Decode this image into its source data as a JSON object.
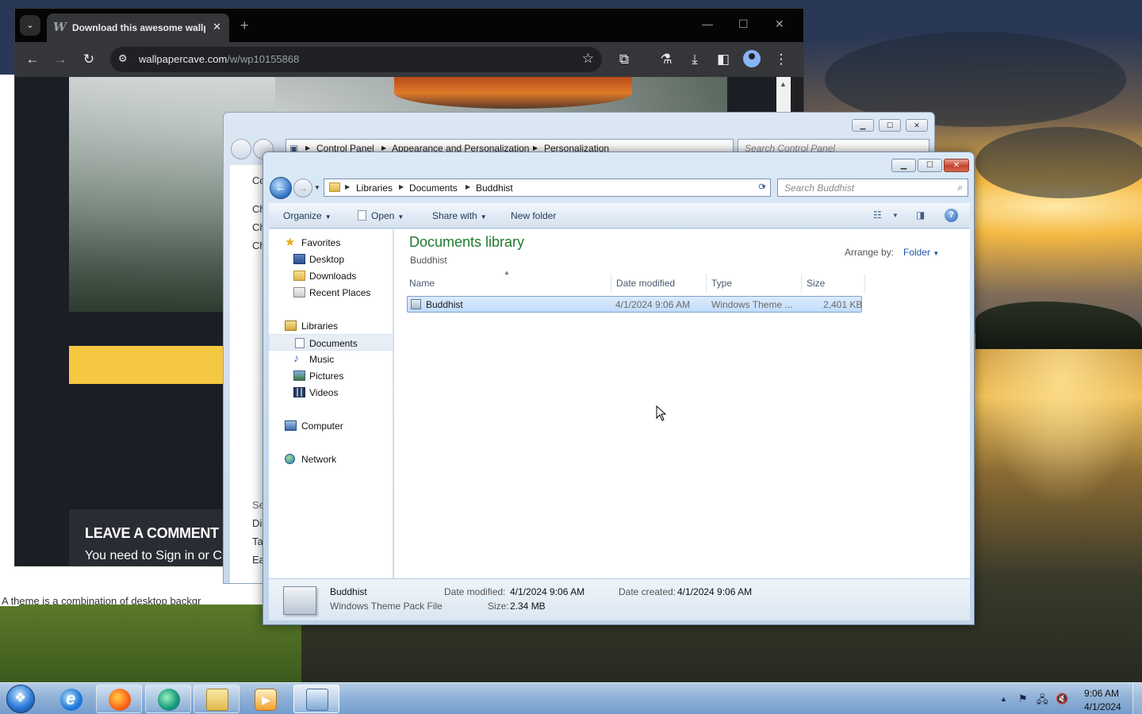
{
  "browser": {
    "tab_title": "Download this awesome wallp",
    "url_host": "wallpapercave.com",
    "url_path": "/w/wp10155868",
    "page": {
      "comment_heading": "LEAVE A COMMENT",
      "comment_sub": "You need to Sign in or Cr"
    },
    "background_text": "A theme is a combination of desktop backgr"
  },
  "control_panel": {
    "breadcrumb": [
      "Control Panel",
      "Appearance and Personalization",
      "Personalization"
    ],
    "search_placeholder": "Search Control Panel",
    "items": [
      "Co",
      "Ch",
      "Ch",
      "Ch",
      "Se",
      "Dis",
      "Ta",
      "Ea"
    ]
  },
  "explorer": {
    "breadcrumb": [
      "Libraries",
      "Documents",
      "Buddhist"
    ],
    "search_placeholder": "Search Buddhist",
    "commands": {
      "organize": "Organize",
      "open": "Open",
      "share_with": "Share with",
      "new_folder": "New folder"
    },
    "nav": {
      "favorites": "Favorites",
      "desktop": "Desktop",
      "downloads": "Downloads",
      "recent": "Recent Places",
      "libraries": "Libraries",
      "documents": "Documents",
      "music": "Music",
      "pictures": "Pictures",
      "videos": "Videos",
      "computer": "Computer",
      "network": "Network"
    },
    "library_title": "Documents library",
    "library_subtitle": "Buddhist",
    "arrange_label": "Arrange by:",
    "arrange_value": "Folder",
    "columns": [
      "Name",
      "Date modified",
      "Type",
      "Size"
    ],
    "files": [
      {
        "name": "Buddhist",
        "modified": "4/1/2024 9:06 AM",
        "type": "Windows Theme ...",
        "size": "2,401 KB"
      }
    ],
    "details": {
      "name": "Buddhist",
      "kind": "Windows Theme Pack File",
      "modified_label": "Date modified:",
      "modified": "4/1/2024 9:06 AM",
      "size_label": "Size:",
      "size": "2.34 MB",
      "created_label": "Date created:",
      "created": "4/1/2024 9:06 AM"
    }
  },
  "taskbar": {
    "time": "9:06 AM",
    "date": "4/1/2024",
    "apps": [
      "internet-explorer",
      "firefox",
      "edge",
      "windows-explorer",
      "media-player",
      "control-panel"
    ]
  },
  "colors": {
    "library_title": "#1e7a2e",
    "selection": "#c1dcfc",
    "chrome_dark": "#35363a",
    "page_yellow": "#f5c842"
  }
}
